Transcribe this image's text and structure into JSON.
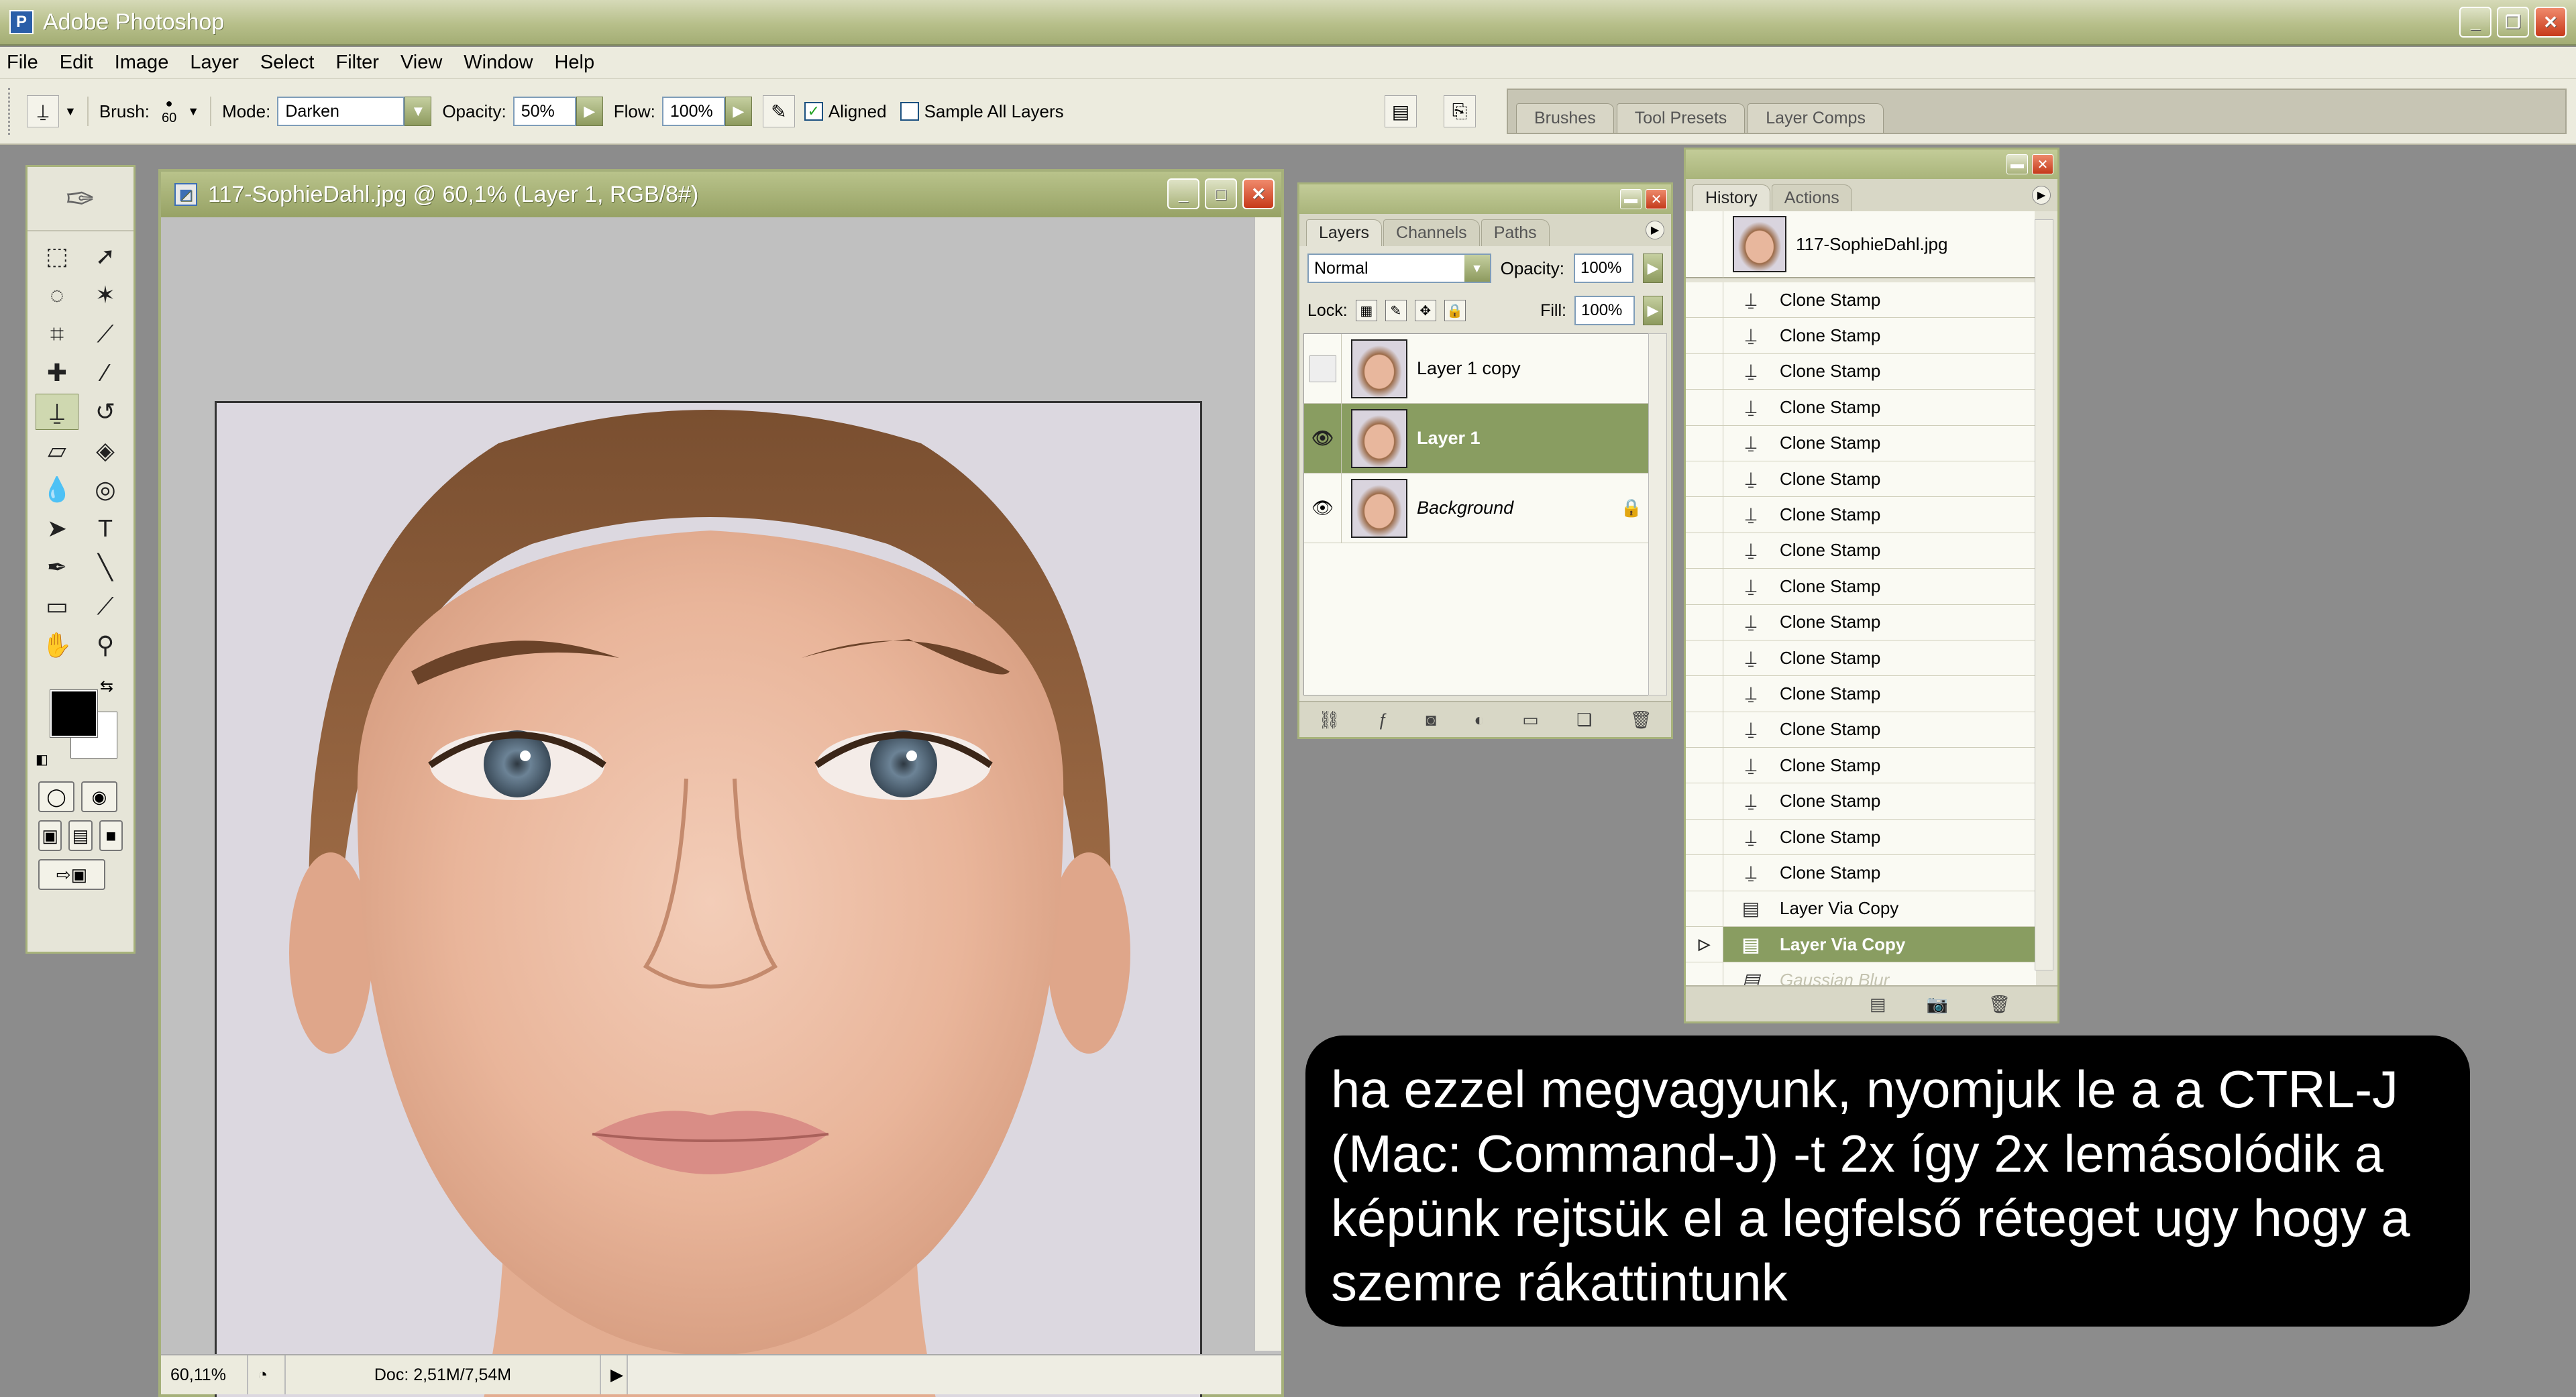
{
  "window": {
    "title": "Adobe Photoshop"
  },
  "menu": [
    "File",
    "Edit",
    "Image",
    "Layer",
    "Select",
    "Filter",
    "View",
    "Window",
    "Help"
  ],
  "options": {
    "brush_label": "Brush:",
    "brush_size": "60",
    "mode_label": "Mode:",
    "mode_value": "Darken",
    "opacity_label": "Opacity:",
    "opacity_value": "50%",
    "flow_label": "Flow:",
    "flow_value": "100%",
    "aligned_label": "Aligned",
    "aligned_checked": true,
    "sample_all_label": "Sample All Layers",
    "sample_all_checked": false
  },
  "palette_well": {
    "tabs": [
      "Brushes",
      "Tool Presets",
      "Layer Comps"
    ]
  },
  "document": {
    "title": "117-SophieDahl.jpg @ 60,1% (Layer 1, RGB/8#)",
    "zoom": "60,11%",
    "doc_size": "Doc: 2,51M/7,54M"
  },
  "layers_panel": {
    "tabs": [
      "Layers",
      "Channels",
      "Paths"
    ],
    "blend_mode": "Normal",
    "opacity_label": "Opacity:",
    "opacity_value": "100%",
    "lock_label": "Lock:",
    "fill_label": "Fill:",
    "fill_value": "100%",
    "layers": [
      {
        "name": "Layer 1 copy",
        "visible": false,
        "selected": false
      },
      {
        "name": "Layer 1",
        "visible": true,
        "selected": true
      },
      {
        "name": "Background",
        "visible": true,
        "selected": false,
        "locked": true
      }
    ]
  },
  "history_panel": {
    "tabs": [
      "History",
      "Actions"
    ],
    "snapshot": "117-SophieDahl.jpg",
    "items": [
      "Clone Stamp",
      "Clone Stamp",
      "Clone Stamp",
      "Clone Stamp",
      "Clone Stamp",
      "Clone Stamp",
      "Clone Stamp",
      "Clone Stamp",
      "Clone Stamp",
      "Clone Stamp",
      "Clone Stamp",
      "Clone Stamp",
      "Clone Stamp",
      "Clone Stamp",
      "Clone Stamp",
      "Clone Stamp",
      "Clone Stamp",
      "Layer Via Copy",
      "Layer Via Copy",
      "Gaussian Blur"
    ],
    "selected_index": 18,
    "dimmed_index": 19
  },
  "caption": {
    "text": "ha ezzel megvagyunk, nyomjuk le a a CTRL-J (Mac: Command-J) -t 2x így 2x lemásolódik a képünk rejtsük el a legfelső réteget ugy hogy a szemre rákattintunk"
  },
  "colors": {
    "accent": "#899d61",
    "frame": "#a7b27b",
    "workspace": "#8c8c8c"
  }
}
